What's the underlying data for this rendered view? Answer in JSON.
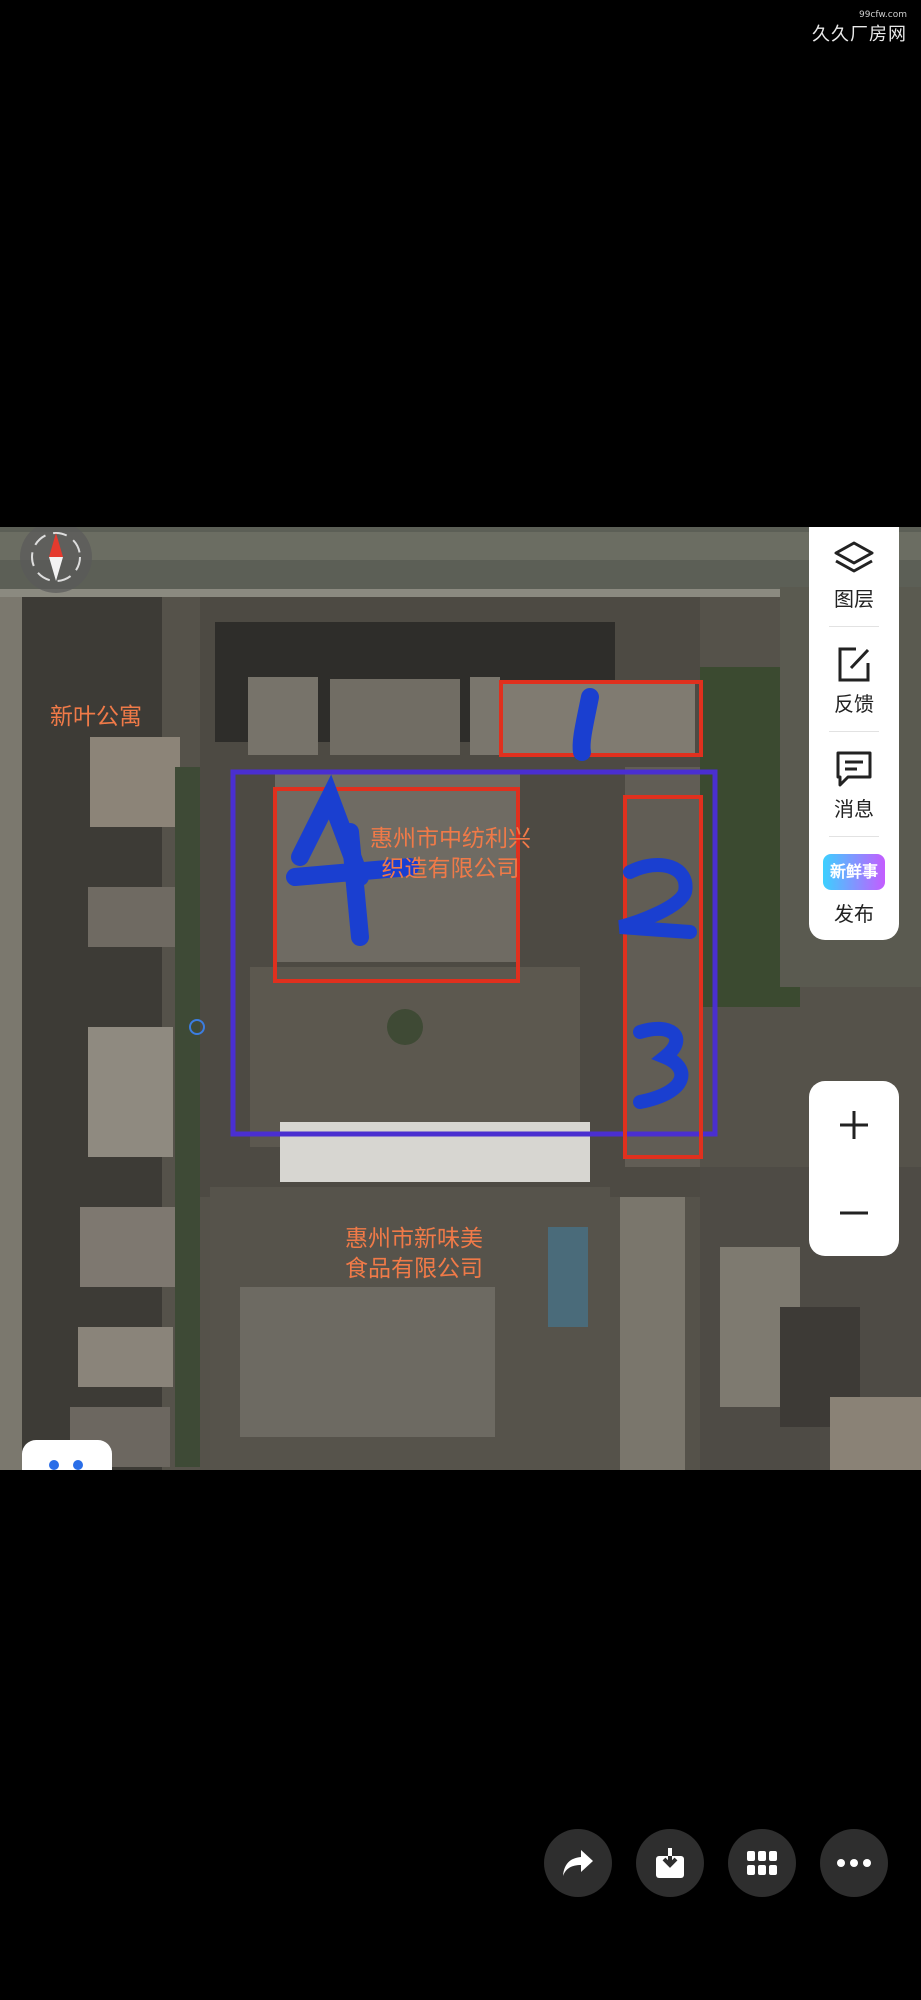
{
  "watermark": {
    "domain": "99cfw.com",
    "brand": "久久厂房网"
  },
  "map": {
    "labels": {
      "xinye": "新叶公寓",
      "company1_line1": "惠州市中纺利兴",
      "company1_line2": "织造有限公司",
      "company2_line1": "惠州市新味美",
      "company2_line2": "食品有限公司"
    },
    "handwritten_numbers": [
      "1",
      "2",
      "3",
      "4"
    ]
  },
  "tools": {
    "layers_label": "图层",
    "feedback_label": "反馈",
    "messages_label": "消息",
    "fresh_badge": "新鲜事",
    "publish_label": "发布"
  },
  "zoom": {
    "in_symbol": "+",
    "out_symbol": "−"
  },
  "colors": {
    "annotation_red": "#e0301e",
    "annotation_purple": "#4a2fd0",
    "annotation_blue": "#1a3fd0",
    "label_orange": "#f07a48"
  },
  "actions": [
    "share-icon",
    "download-icon",
    "grid-icon",
    "more-icon"
  ]
}
